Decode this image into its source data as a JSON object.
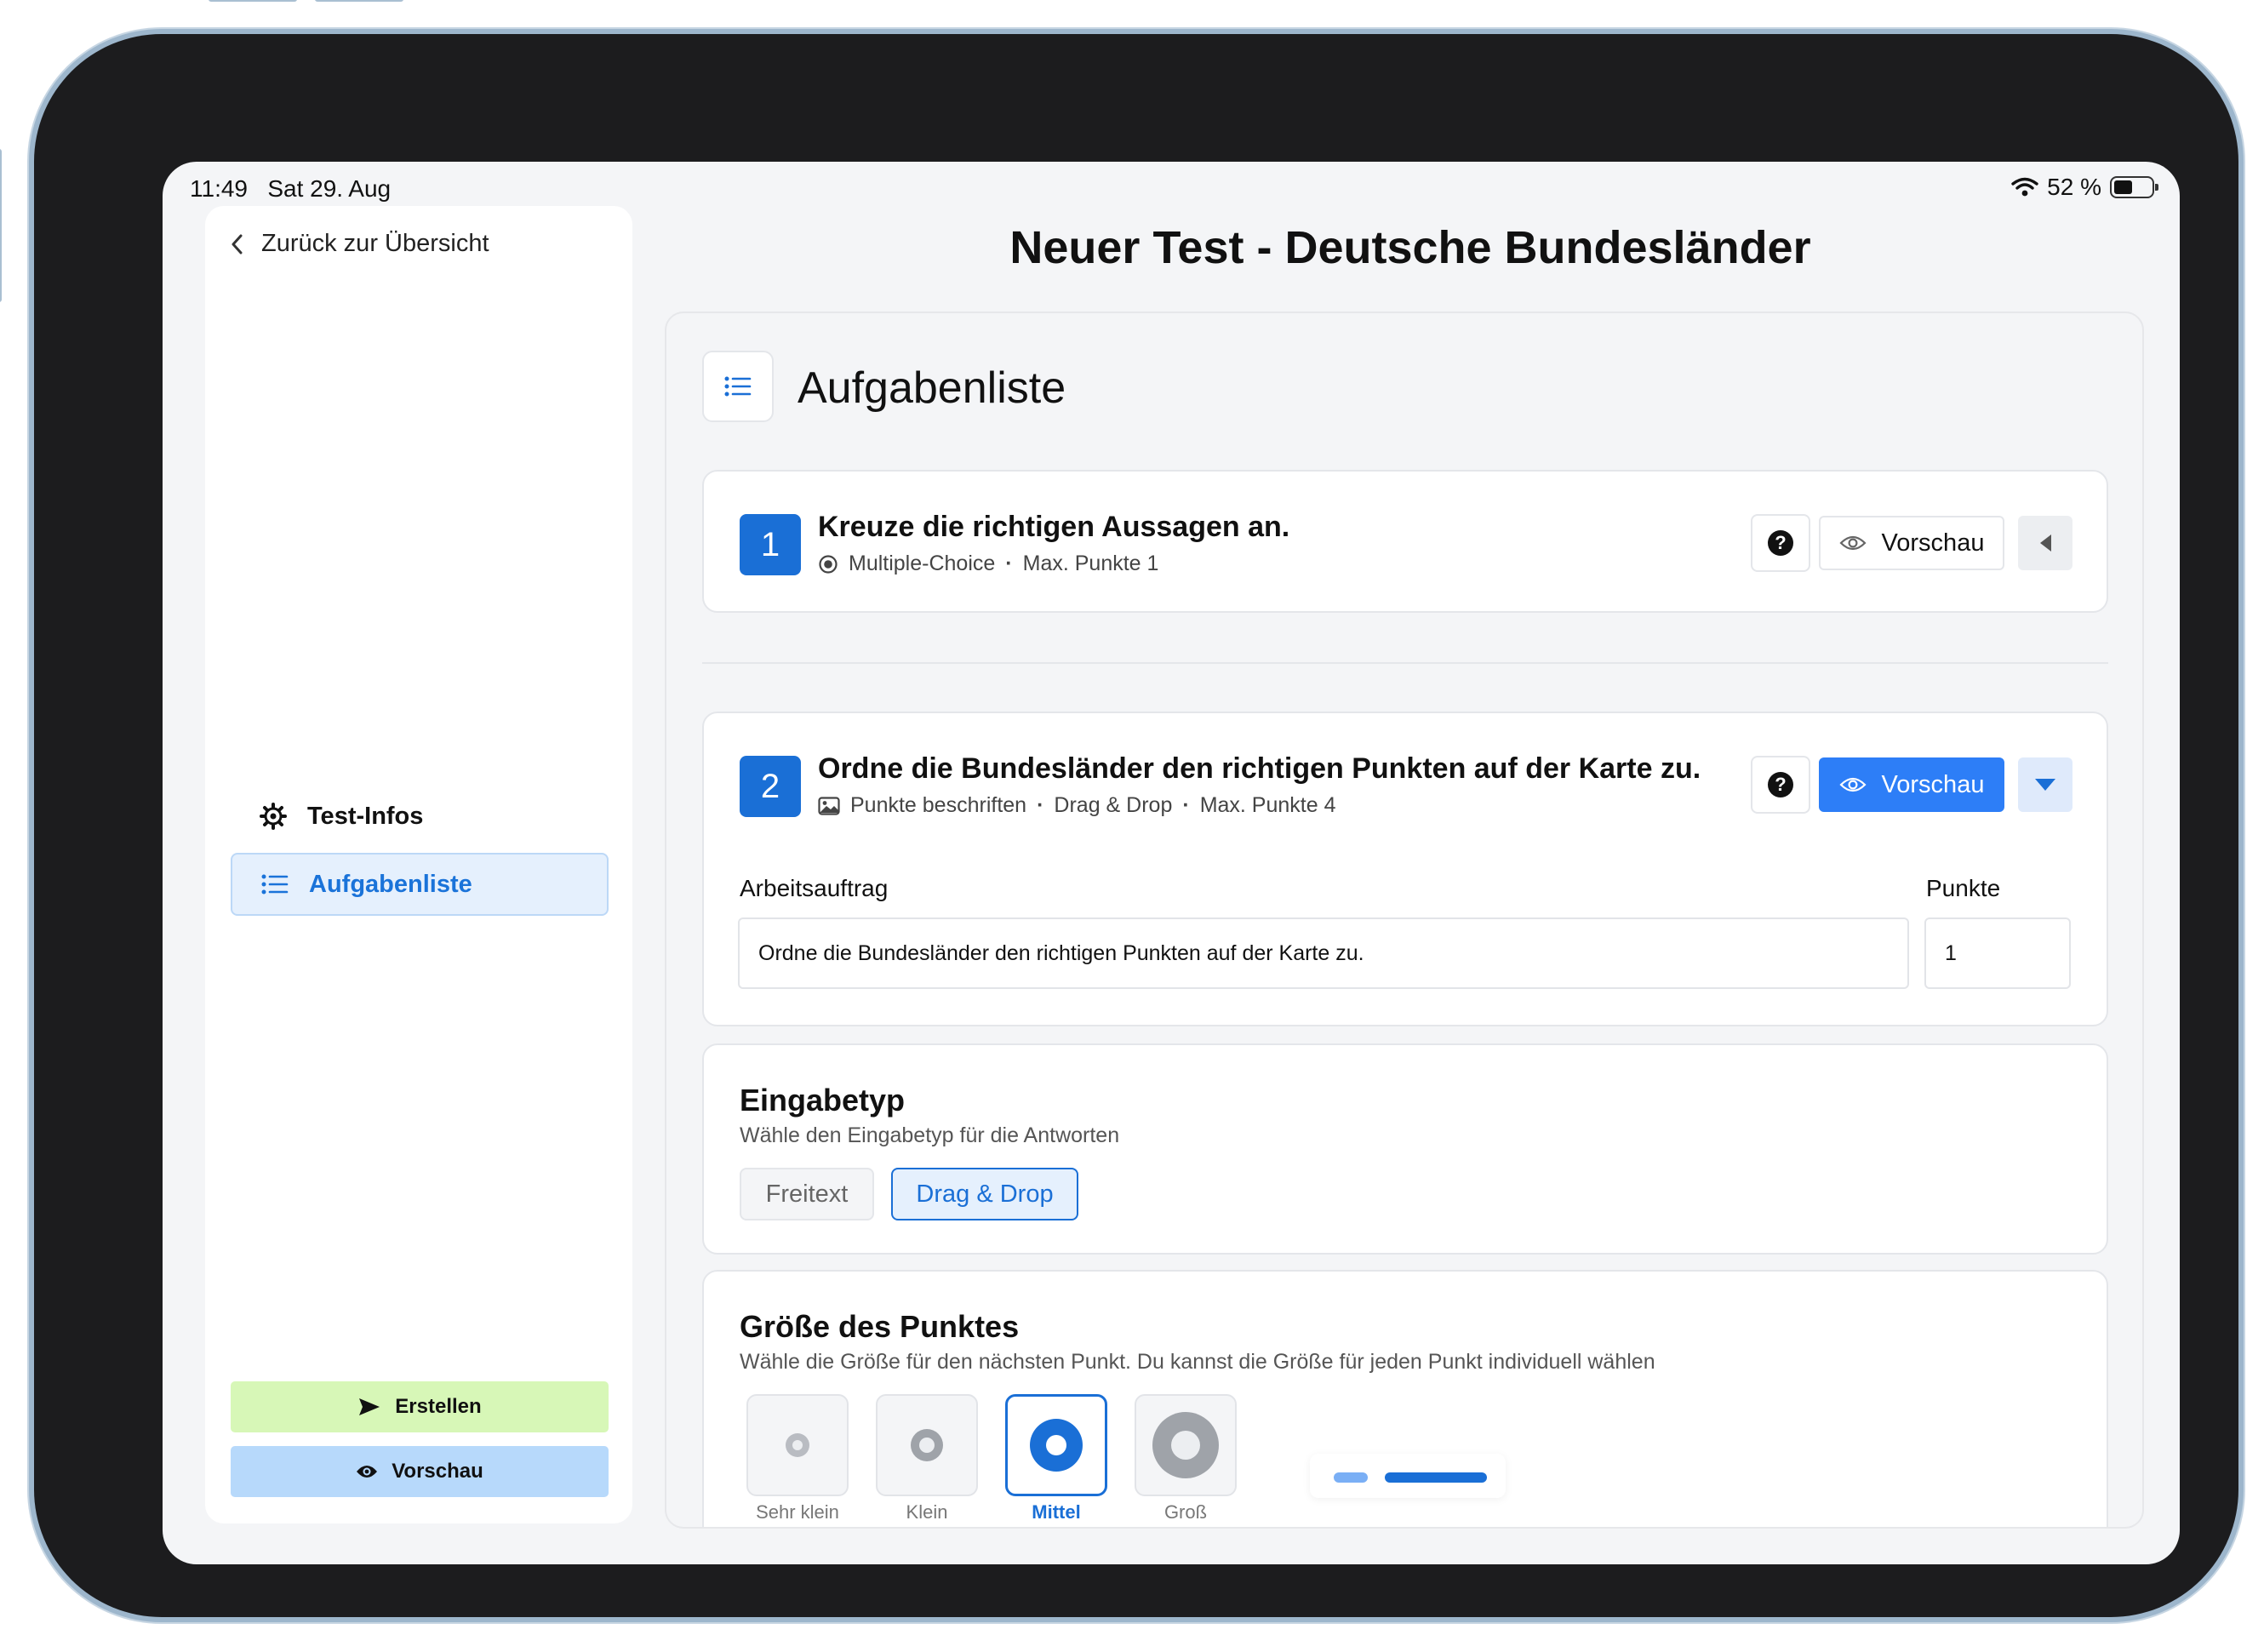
{
  "status": {
    "time": "11:49",
    "date": "Sat 29. Aug",
    "battery": "52 %",
    "battery_level": 0.52
  },
  "sidebar": {
    "back_label": "Zurück zur Übersicht",
    "items": [
      {
        "label": "Test-Infos",
        "icon": "gear-icon",
        "active": false
      },
      {
        "label": "Aufgabenliste",
        "icon": "list-icon",
        "active": true
      }
    ],
    "create_label": "Erstellen",
    "preview_label": "Vorschau"
  },
  "page_title": "Neuer Test - Deutsche Bundesländer",
  "section_title": "Aufgabenliste",
  "tasks": [
    {
      "number": "1",
      "title": "Kreuze die richtigen Aussagen an.",
      "type": "Multiple-Choice",
      "type_icon": "radio-icon",
      "max_points": "Max. Punkte 1",
      "preview_label": "Vorschau",
      "expanded": false
    },
    {
      "number": "2",
      "title": "Ordne die Bundesländer den richtigen Punkten auf der Karte zu.",
      "type": "Punkte beschriften",
      "type_icon": "image-icon",
      "subtype": "Drag & Drop",
      "max_points": "Max. Punkte 4",
      "preview_label": "Vorschau",
      "expanded": true,
      "assignment_label": "Arbeitsauftrag",
      "assignment_value": "Ordne die Bundesländer den richtigen Punkten auf der Karte zu.",
      "points_label": "Punkte",
      "points_value": "1"
    }
  ],
  "input_type": {
    "title": "Eingabetyp",
    "description": "Wähle den Eingabetyp für die Antworten",
    "options": [
      {
        "label": "Freitext",
        "selected": false
      },
      {
        "label": "Drag & Drop",
        "selected": true
      }
    ]
  },
  "point_size": {
    "title": "Größe des Punktes",
    "description": "Wähle die Größe für den nächsten Punkt. Du kannst die Größe für jeden Punkt individuell wählen",
    "options": [
      {
        "label": "Sehr klein",
        "selected": false
      },
      {
        "label": "Klein",
        "selected": false
      },
      {
        "label": "Mittel",
        "selected": true
      },
      {
        "label": "Groß",
        "selected": false
      }
    ]
  },
  "colors": {
    "primary": "#1a6fd6",
    "preview_blue": "#2d7ef7",
    "create_green": "#d7f7b7",
    "preview_light": "#b7d9fb"
  }
}
